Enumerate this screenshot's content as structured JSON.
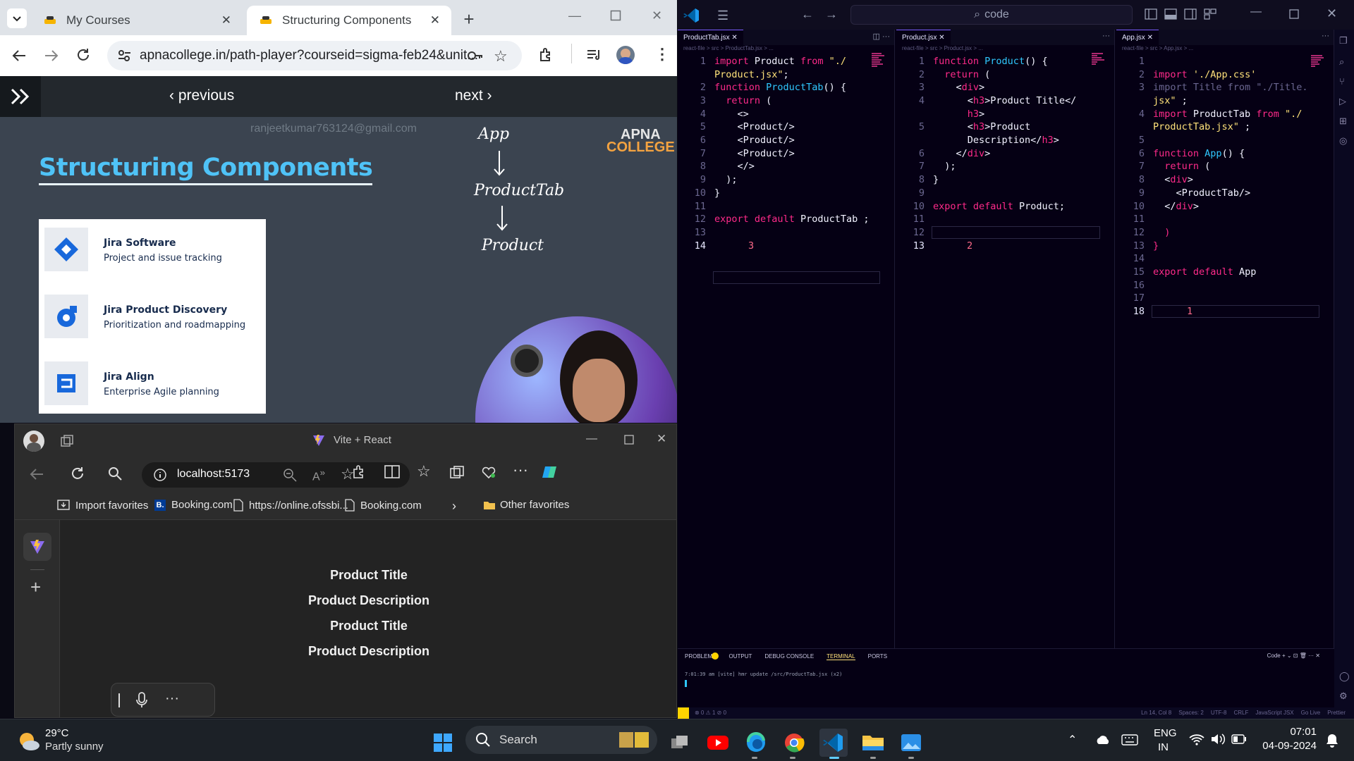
{
  "chrome": {
    "tabs": [
      {
        "label": "My Courses",
        "active": false
      },
      {
        "label": "Structuring Components",
        "active": true
      }
    ],
    "url": "apnacollege.in/path-player?courseid=sigma-feb24&unit...",
    "lesson_nav": {
      "previous": "previous",
      "next": "next"
    },
    "slide": {
      "watermark": "ranjeetkumar763124@gmail.com",
      "title": "Structuring Components",
      "logo_line1": "APNA",
      "logo_line2": "COLLEGE",
      "handwriting": [
        "App",
        "ProductTab",
        "Product"
      ],
      "jira_items": [
        {
          "title": "Jira Software",
          "desc": "Project and issue tracking"
        },
        {
          "title": "Jira Product Discovery",
          "desc": "Prioritization and roadmapping"
        },
        {
          "title": "Jira Align",
          "desc": "Enterprise Agile planning"
        }
      ]
    }
  },
  "edge": {
    "title": "Vite + React",
    "address": "localhost:5173",
    "favorites": [
      "Import favorites",
      "Booking.com",
      "https://online.ofssbi...",
      "Booking.com",
      "Other favorites"
    ],
    "content": [
      "Product Title",
      "Product Description",
      "Product Title",
      "Product Description"
    ]
  },
  "vscode": {
    "search": "code",
    "panes": [
      {
        "tab": "ProductTab.jsx",
        "crumb": "react-file > src > ProductTab.jsx > ...",
        "cursor_line": "14",
        "ghost": "3"
      },
      {
        "tab": "Product.jsx",
        "crumb": "react-file > src > Product.jsx > ...",
        "cursor_line": "13",
        "ghost": "2"
      },
      {
        "tab": "App.jsx",
        "crumb": "react-file > src > App.jsx > ...",
        "cursor_line": "18",
        "ghost": "1"
      }
    ],
    "panel_tabs": [
      "PROBLEMS",
      "OUTPUT",
      "DEBUG CONSOLE",
      "TERMINAL",
      "PORTS"
    ],
    "terminal_line": "7:01:39 am [vite] hmr update /src/ProductTab.jsx (x2)",
    "terminal_profile": "Code",
    "status_right": [
      "Ln 14, Col 8",
      "Spaces: 2",
      "UTF-8",
      "CRLF",
      "JavaScript JSX",
      "Go Live",
      "Prettier"
    ]
  },
  "taskbar": {
    "weather_temp": "29°C",
    "weather_desc": "Partly sunny",
    "search": "Search",
    "lang1": "ENG",
    "lang2": "IN",
    "time": "07:01",
    "date": "04-09-2024"
  },
  "colors": {
    "vscode_keyword": "#ff2a8a",
    "vscode_function": "#30c8ff",
    "vscode_string": "#ffe27a",
    "slide_title": "#4fc3f7"
  }
}
